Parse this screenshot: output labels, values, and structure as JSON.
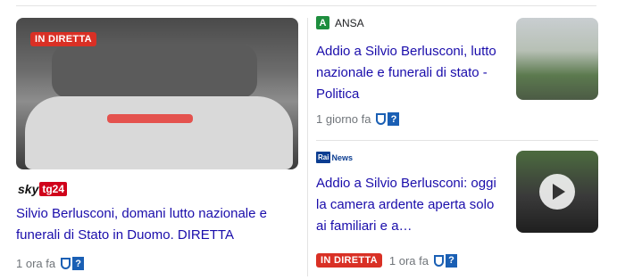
{
  "left_story": {
    "badge": "IN DIRETTA",
    "source": {
      "word": "sky",
      "tag": "tg24"
    },
    "headline": "Silvio Berlusconi, domani lutto nazionale e funerali di Stato in Duomo. DIRETTA",
    "time": "1 ora fa"
  },
  "right_stories": [
    {
      "source": {
        "mark": "A",
        "name": "ANSA"
      },
      "headline": "Addio a Silvio Berlusconi, lutto nazionale e funerali di stato - Politica",
      "time": "1 giorno fa"
    },
    {
      "source": {
        "mark": "Rai",
        "name": "News"
      },
      "headline": "Addio a Silvio Berlusconi: oggi la camera ardente aperta solo ai familiari e a…",
      "badge": "IN DIRETTA",
      "time": "1 ora fa"
    }
  ],
  "fact_check": {
    "qmark": "?"
  },
  "colors": {
    "link": "#1a0dab",
    "live": "#d93025",
    "ansa": "#1e8e3e",
    "rai": "#0b3d91"
  },
  "icons": [
    "shield-icon",
    "question-icon",
    "play-icon"
  ]
}
